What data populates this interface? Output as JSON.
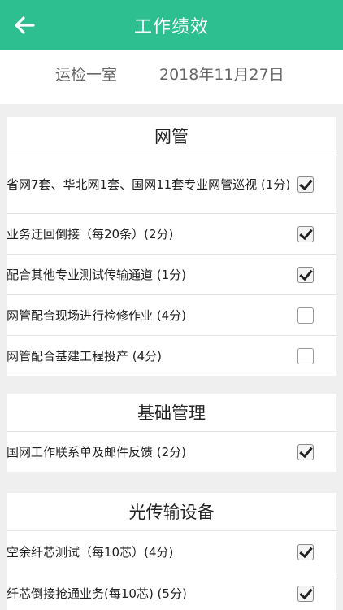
{
  "header": {
    "title": "工作绩效",
    "back_icon": "arrow-left-icon"
  },
  "subheader": {
    "department": "运检一室",
    "date": "2018年11月27日"
  },
  "colors": {
    "primary": "#2dbf8f",
    "background": "#efefef"
  },
  "sections": [
    {
      "title": "网管",
      "items": [
        {
          "label": "省网7套、华北网1套、国网11套专业网管巡视 (1分)",
          "checked": true
        },
        {
          "label": "业务迂回倒接（每20条）(2分)",
          "checked": true
        },
        {
          "label": "配合其他专业测试传输通道 (1分)",
          "checked": true
        },
        {
          "label": "网管配合现场进行检修作业 (4分)",
          "checked": false
        },
        {
          "label": "网管配合基建工程投产 (4分)",
          "checked": false
        }
      ]
    },
    {
      "title": "基础管理",
      "items": [
        {
          "label": "国网工作联系单及邮件反馈 (2分)",
          "checked": true
        }
      ]
    },
    {
      "title": "光传输设备",
      "items": [
        {
          "label": "空余纤芯测试（每10芯）(4分)",
          "checked": true
        },
        {
          "label": "纤芯倒接抢通业务(每10芯) (5分)",
          "checked": true
        }
      ]
    }
  ]
}
